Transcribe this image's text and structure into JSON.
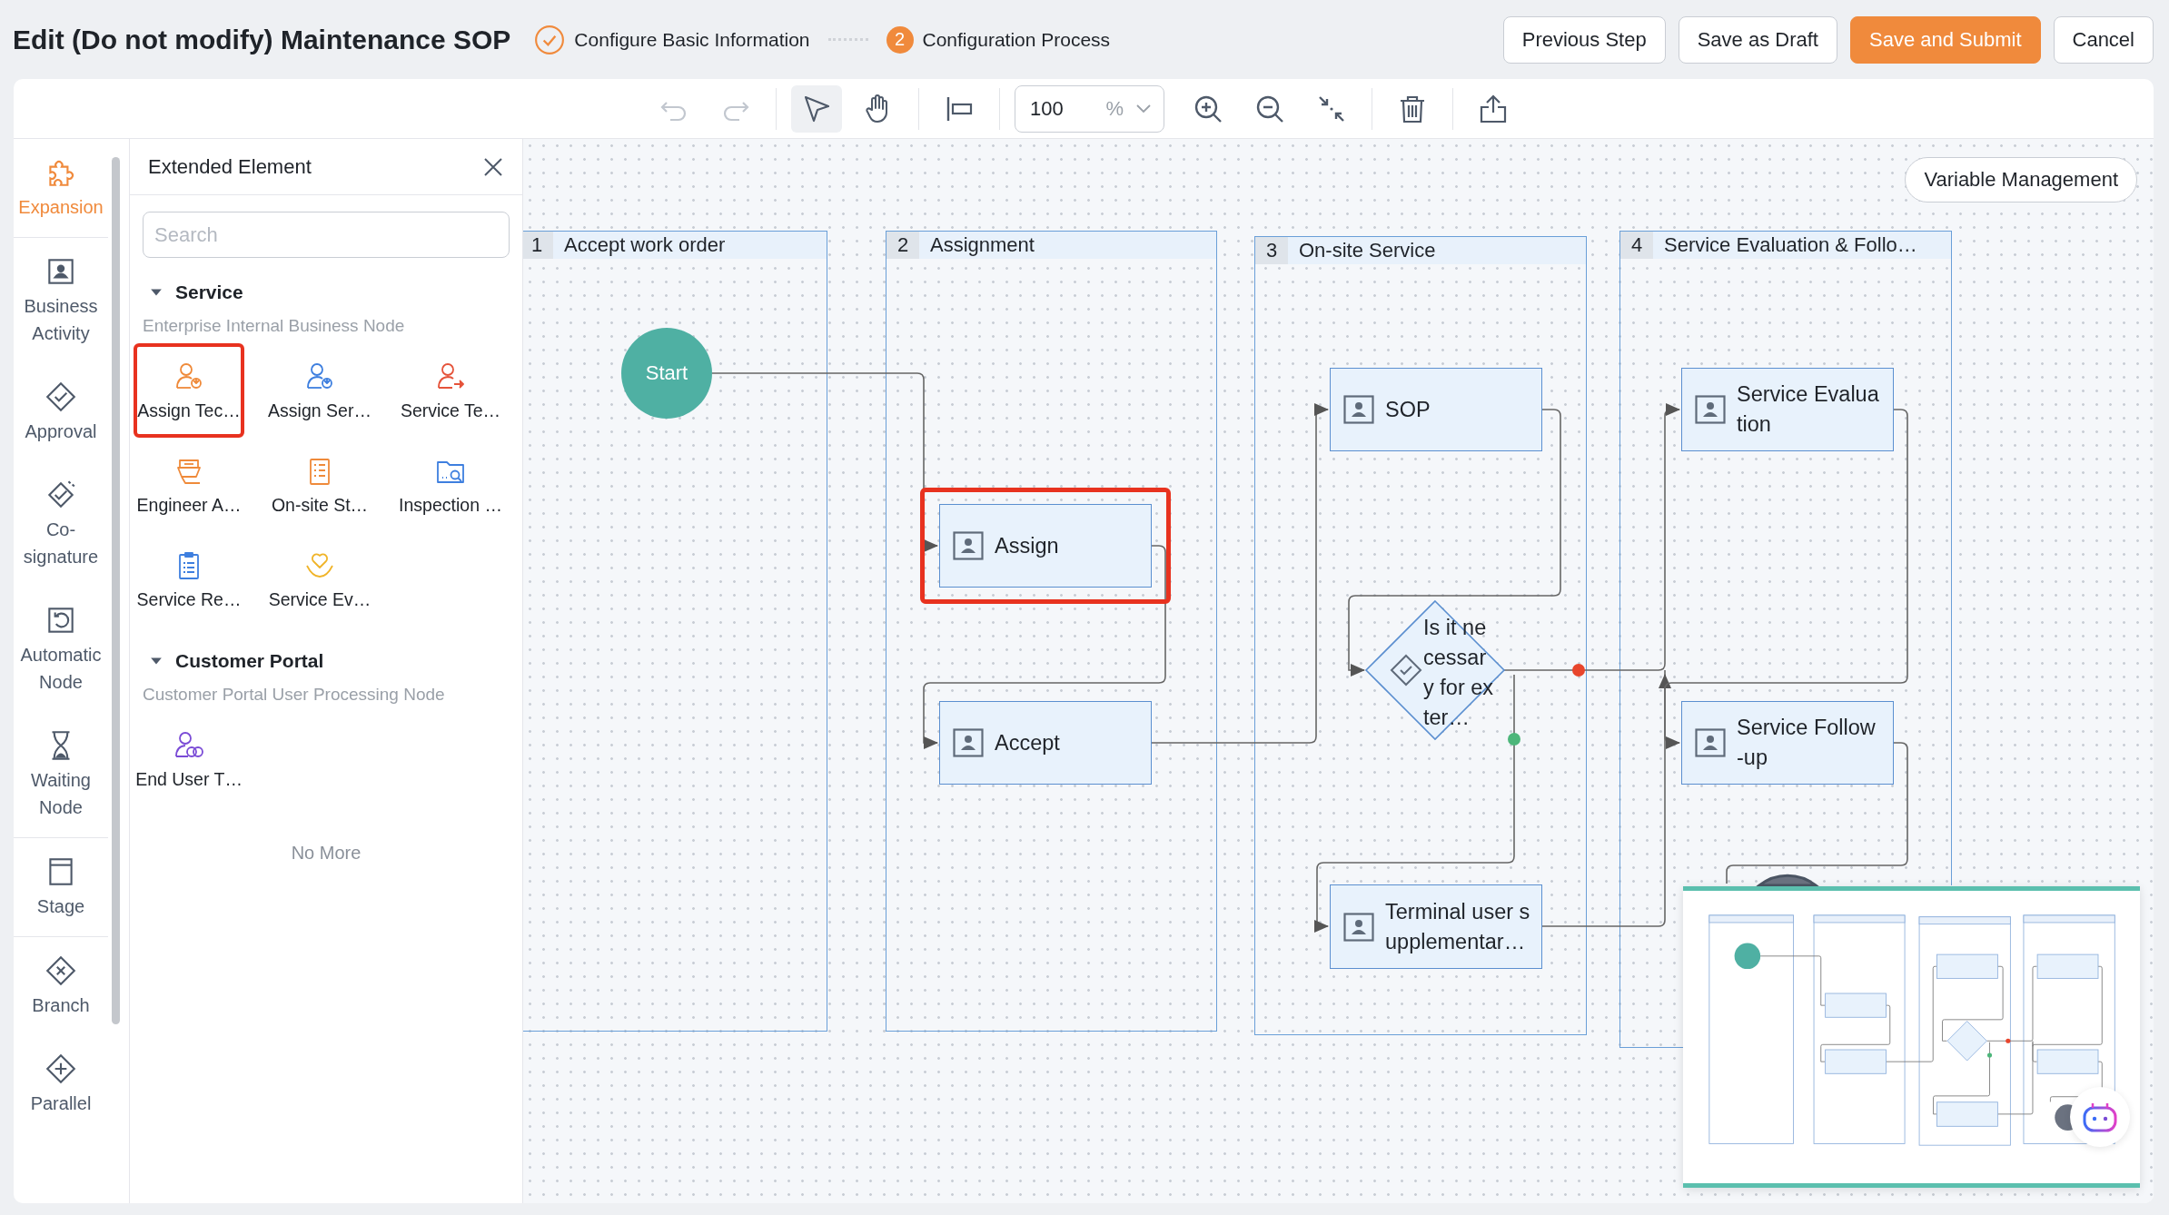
{
  "title": "Edit (Do not modify) Maintenance SOP",
  "steps": [
    {
      "label": "Configure Basic Information",
      "completed": true
    },
    {
      "number": "2",
      "label": "Configuration Process",
      "completed": false
    }
  ],
  "actions": [
    {
      "label": "Previous Step",
      "primary": false
    },
    {
      "label": "Save as Draft",
      "primary": false
    },
    {
      "label": "Save and Submit",
      "primary": true
    },
    {
      "label": "Cancel",
      "primary": false
    }
  ],
  "toolbar": {
    "history": [
      {
        "kind": "undo",
        "disabled": true
      },
      {
        "kind": "redo",
        "disabled": true
      }
    ],
    "modes": [
      {
        "kind": "select",
        "selected": true
      },
      {
        "kind": "pan",
        "selected": false
      }
    ],
    "zoom": {
      "value": "100",
      "unit": "%"
    }
  },
  "nav": [
    {
      "kind": "expansion",
      "label": "Expansion",
      "selected": true
    },
    {
      "kind": "business",
      "label": "Business Activity",
      "selected": false
    },
    {
      "kind": "approval",
      "label": "Approval",
      "selected": false
    },
    {
      "kind": "cosign",
      "label": "Co-signature",
      "selected": false
    },
    {
      "kind": "automatic",
      "label": "Automatic Node",
      "selected": false
    },
    {
      "kind": "waiting",
      "label": "Waiting Node",
      "selected": false
    },
    {
      "kind": "stage",
      "label": "Stage",
      "selected": false
    },
    {
      "kind": "branch",
      "label": "Branch",
      "selected": false
    },
    {
      "kind": "parallel",
      "label": "Parallel",
      "selected": false
    }
  ],
  "panel": {
    "title": "Extended Element",
    "search": {
      "placeholder": "Search"
    },
    "sections": [
      {
        "title": "Service",
        "expanded": true,
        "subtitle": "Enterprise Internal Business Node",
        "items": [
          {
            "kind": "assign-tech",
            "label": "Assign Tec…",
            "selected": true
          },
          {
            "kind": "assign-service",
            "label": "Assign Ser…",
            "selected": false
          },
          {
            "kind": "service-team",
            "label": "Service Te…",
            "selected": false
          },
          {
            "kind": "engineer",
            "label": "Engineer A…",
            "selected": false
          },
          {
            "kind": "onsite",
            "label": "On-site St…",
            "selected": false
          },
          {
            "kind": "inspection",
            "label": "Inspection …",
            "selected": false
          },
          {
            "kind": "record",
            "label": "Service Re…",
            "selected": false
          },
          {
            "kind": "evaluation",
            "label": "Service Ev…",
            "selected": false
          }
        ]
      },
      {
        "title": "Customer Portal",
        "expanded": true,
        "subtitle": "Customer Portal User Processing Node",
        "items": [
          {
            "kind": "end-user",
            "label": "End User T…",
            "selected": false
          }
        ]
      }
    ],
    "footer": "No More"
  },
  "canvas": {
    "variable_button": "Variable Management",
    "lanes": [
      {
        "number": "1",
        "title": "Accept work order"
      },
      {
        "number": "2",
        "title": "Assignment"
      },
      {
        "number": "3",
        "title": "On-site Service"
      },
      {
        "number": "4",
        "title": "Service Evaluation & Follo…"
      }
    ],
    "nodes": [
      {
        "kind": "start",
        "label": "Start",
        "selected": false
      },
      {
        "kind": "task",
        "label": "Assign",
        "selected": true
      },
      {
        "kind": "task",
        "label": "Accept",
        "selected": false
      },
      {
        "kind": "task",
        "label": "SOP",
        "selected": false
      },
      {
        "kind": "gateway",
        "label": "Is it necessary for exter…",
        "selected": false
      },
      {
        "kind": "task",
        "label": "Terminal user supplementar…",
        "selected": false
      },
      {
        "kind": "task",
        "label": "Service Evaluation",
        "selected": false
      },
      {
        "kind": "task",
        "label": "Service Follow-up",
        "selected": false
      },
      {
        "kind": "end",
        "selected": false
      }
    ]
  }
}
